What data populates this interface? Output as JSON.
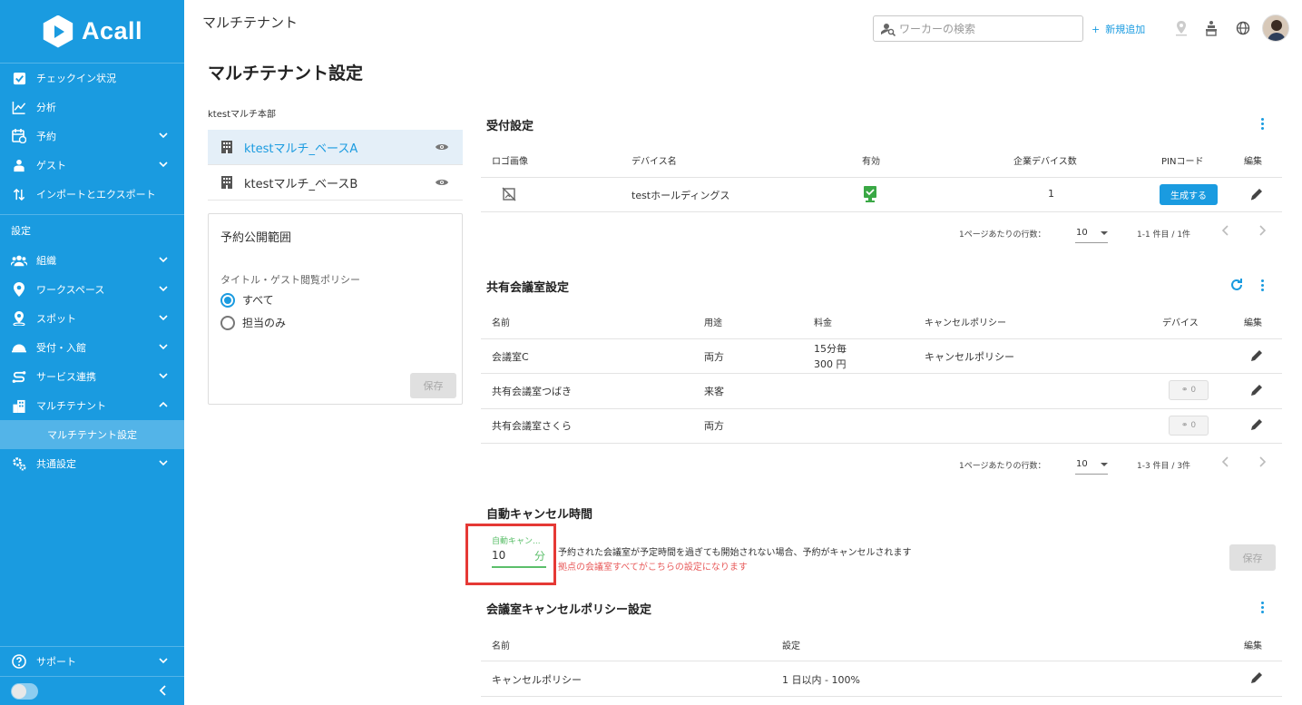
{
  "app": {
    "name": "Acall"
  },
  "sidebar": {
    "items": [
      {
        "label": "チェックイン状況",
        "icon": "checkbox-icon"
      },
      {
        "label": "分析",
        "icon": "chart-line-icon"
      },
      {
        "label": "予約",
        "icon": "calendar-icon"
      },
      {
        "label": "ゲスト",
        "icon": "guest-icon"
      },
      {
        "label": "インポートとエクスポート",
        "icon": "import-export-icon"
      }
    ],
    "settings_heading": "設定",
    "settings_items": [
      {
        "label": "組織",
        "icon": "people-icon"
      },
      {
        "label": "ワークスペース",
        "icon": "map-pin-icon"
      },
      {
        "label": "スポット",
        "icon": "spot-pin-icon"
      },
      {
        "label": "受付・入館",
        "icon": "reception-bell-icon"
      },
      {
        "label": "サービス連携",
        "icon": "integration-icon"
      },
      {
        "label": "マルチテナント",
        "icon": "building-icon"
      }
    ],
    "sub_item": "マルチテナント設定",
    "common": {
      "label": "共通設定",
      "icon": "gear-icon"
    },
    "support": {
      "label": "サポート",
      "icon": "help-icon"
    }
  },
  "header": {
    "crumb": "マルチテナント",
    "search_placeholder": "ワーカーの検索",
    "new_add": "新規追加"
  },
  "page": {
    "title": "マルチテナント設定",
    "hq_label": "ktestマルチ本部",
    "bases": [
      "ktestマルチ_ベースA",
      "ktestマルチ_ベースB"
    ],
    "scope": {
      "title": "予約公開範囲",
      "policy_label": "タイトル・ゲスト閲覧ポリシー",
      "options": [
        "すべて",
        "担当のみ"
      ],
      "selected": "すべて",
      "save": "保存"
    }
  },
  "reception": {
    "title": "受付設定",
    "headers": [
      "ロゴ画像",
      "デバイス名",
      "有効",
      "企業デバイス数",
      "PINコード",
      "編集"
    ],
    "row": {
      "device_name": "testホールディングス",
      "device_count": "1",
      "pin_button": "生成する",
      "enabled": true
    },
    "pager": {
      "rows_label": "1ページあたりの行数：",
      "rows_value": "10",
      "range": "1-1 件目 / 1件"
    }
  },
  "shared_rooms": {
    "title": "共有会議室設定",
    "headers": [
      "名前",
      "用途",
      "料金",
      "キャンセルポリシー",
      "デバイス",
      "編集"
    ],
    "rows": [
      {
        "name": "会議室C",
        "usage": "両方",
        "fee_line1": "15分毎",
        "fee_line2": "300 円",
        "policy": "キャンセルポリシー",
        "device": ""
      },
      {
        "name": "共有会議室つばき",
        "usage": "来客",
        "fee_line1": "",
        "fee_line2": "",
        "policy": "",
        "device": "0"
      },
      {
        "name": "共有会議室さくら",
        "usage": "両方",
        "fee_line1": "",
        "fee_line2": "",
        "policy": "",
        "device": "0"
      }
    ],
    "pager": {
      "rows_label": "1ページあたりの行数：",
      "rows_value": "10",
      "range": "1-3 件目 / 3件"
    }
  },
  "auto_cancel": {
    "title": "自動キャンセル時間",
    "field_label": "自動キャン...",
    "value": "10",
    "unit": "分",
    "description": "予約された会議室が予定時間を過ぎても開始されない場合、予約がキャンセルされます",
    "note": "拠点の会議室すべてがこちらの設定になります",
    "save": "保存"
  },
  "cancel_policy": {
    "title": "会議室キャンセルポリシー設定",
    "headers": [
      "名前",
      "設定",
      "編集"
    ],
    "row": {
      "name": "キャンセルポリシー",
      "setting": "1 日以内 - 100%"
    }
  },
  "colors": {
    "accent": "#1a9be0",
    "highlight": "#e53935",
    "success": "#5bbf6a",
    "warning_text": "#e85b5b"
  }
}
